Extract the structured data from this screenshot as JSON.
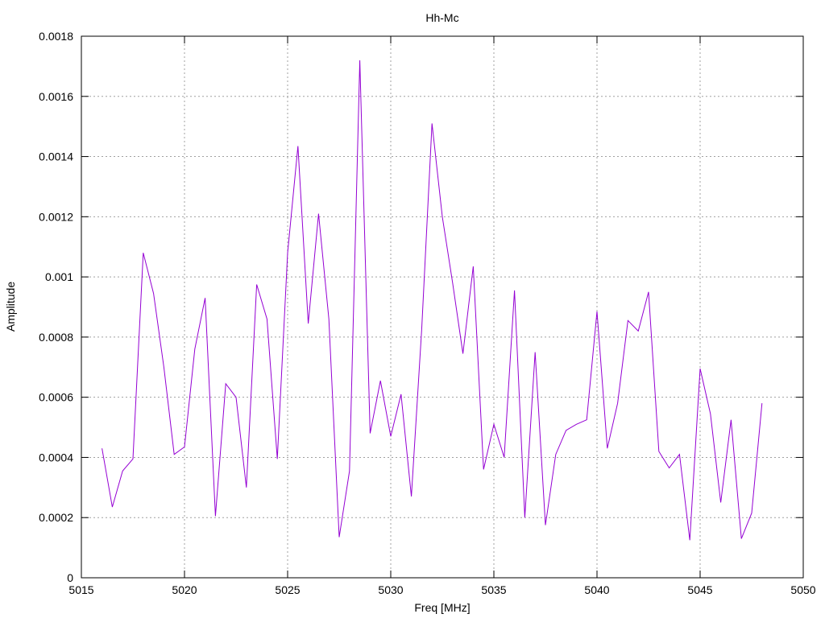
{
  "chart_data": {
    "type": "line",
    "title": "Hh-Mc",
    "xlabel": "Freq [MHz]",
    "ylabel": "Amplitude",
    "xlim": [
      5015,
      5050
    ],
    "ylim": [
      0,
      0.0018
    ],
    "grid": true,
    "line_color": "#9400d3",
    "xticks": [
      "5015",
      "5020",
      "5025",
      "5030",
      "5035",
      "5040",
      "5045",
      "5050"
    ],
    "yticks": [
      "0",
      "0.0002",
      "0.0004",
      "0.0006",
      "0.0008",
      "0.001",
      "0.0012",
      "0.0014",
      "0.0016",
      "0.0018"
    ],
    "series": [
      {
        "x": [
          5016.0,
          5016.5,
          5017.0,
          5017.5,
          5018.0,
          5018.5,
          5019.0,
          5019.5,
          5020.0,
          5020.5,
          5021.0,
          5021.5,
          5022.0,
          5022.5,
          5023.0,
          5023.5,
          5024.0,
          5024.5,
          5025.0,
          5025.5,
          5026.0,
          5026.5,
          5027.0,
          5027.5,
          5028.0,
          5028.5,
          5029.0,
          5029.5,
          5030.0,
          5030.5,
          5031.0,
          5031.5,
          5032.0,
          5032.5,
          5033.0,
          5033.5,
          5034.0,
          5034.5,
          5035.0,
          5035.5,
          5036.0,
          5036.5,
          5037.0,
          5037.5,
          5038.0,
          5038.5,
          5039.0,
          5039.5,
          5040.0,
          5040.5,
          5041.0,
          5041.5,
          5042.0,
          5042.5,
          5043.0,
          5043.5,
          5044.0,
          5044.5,
          5045.0,
          5045.5,
          5046.0,
          5046.5,
          5047.0,
          5047.5,
          5048.0
        ],
        "y": [
          0.00043,
          0.000235,
          0.000355,
          0.000395,
          0.00108,
          0.000945,
          0.0007,
          0.00041,
          0.000435,
          0.00076,
          0.00093,
          0.000205,
          0.000645,
          0.0006,
          0.0003,
          0.000975,
          0.00086,
          0.000395,
          0.00108,
          0.001435,
          0.000845,
          0.00121,
          0.00086,
          0.000135,
          0.000355,
          0.00172,
          0.00048,
          0.000655,
          0.00047,
          0.00061,
          0.00027,
          0.000825,
          0.00151,
          0.0012,
          0.00098,
          0.000745,
          0.001035,
          0.00036,
          0.00051,
          0.0004,
          0.000955,
          0.0002,
          0.00075,
          0.000175,
          0.00041,
          0.00049,
          0.00051,
          0.000525,
          0.000885,
          0.00043,
          0.00058,
          0.000855,
          0.00082,
          0.00095,
          0.00042,
          0.000365,
          0.00041,
          0.000125,
          0.000695,
          0.000545,
          0.00025,
          0.000525,
          0.00013,
          0.000215,
          0.00058
        ]
      }
    ]
  }
}
